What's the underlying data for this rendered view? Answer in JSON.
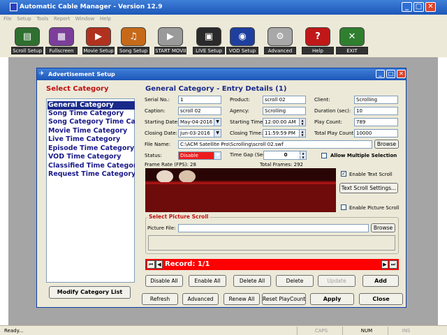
{
  "window": {
    "title": "Automatic Cable Manager - Version 12.9",
    "minimize": "_",
    "restore": "□",
    "close": "✕"
  },
  "menu": [
    "File",
    "Setup",
    "Tools",
    "Report",
    "Window",
    "Help"
  ],
  "toolbar": [
    {
      "label": "Scroll Setup",
      "icon": "scroll-setup-icon",
      "color": "#2f6f2f",
      "glyph": "▤"
    },
    {
      "label": "Fullscreen",
      "icon": "fullscreen-icon",
      "color": "#7b3f9a",
      "glyph": "▦"
    },
    {
      "label": "Movie Setup",
      "icon": "movie-setup-icon",
      "color": "#b0321e",
      "glyph": "▶"
    },
    {
      "label": "Song Setup",
      "icon": "song-setup-icon",
      "color": "#c66a1a",
      "glyph": "♫"
    },
    {
      "label": "START MOVIE",
      "icon": "start-movie-icon",
      "color": "#9a9a9a",
      "glyph": "▶"
    },
    {
      "label": "LIVE Setup",
      "icon": "live-setup-icon",
      "color": "#2a2a2a",
      "glyph": "▣"
    },
    {
      "label": "VOD Setup",
      "icon": "vod-setup-icon",
      "color": "#1f3f9f",
      "glyph": "◉"
    },
    {
      "label": "Advanced",
      "icon": "advanced-icon",
      "color": "#a8a8a8",
      "glyph": "⚙"
    },
    {
      "label": "Help",
      "icon": "help-icon",
      "color": "#c01818",
      "glyph": "?"
    },
    {
      "label": "EXIT",
      "icon": "exit-icon",
      "color": "#2f7f2f",
      "glyph": "✕"
    }
  ],
  "dialog": {
    "title": "Advertisement Setup",
    "select_category_label": "Select Category",
    "categories": [
      "General Category",
      "Song Time Category",
      "Song Category Time Cat",
      "Movie Time Category",
      "Live Time Category",
      "Episode Time Category",
      "VOD Time Category",
      "Classified Time Category",
      "Request Time Category"
    ],
    "modify_button": "Modify Category List",
    "entry_heading": "General Category - Entry Details (1)",
    "fields": {
      "serial_label": "Serial No.:",
      "serial": "1",
      "product_label": "Product:",
      "product": "scroll 02",
      "client_label": "Client:",
      "client": "Scrolling",
      "caption_label": "Caption:",
      "caption": "scroll 02",
      "agency_label": "Agency:",
      "agency": "Scrolling",
      "duration_label": "Duration (sec):",
      "duration": "10",
      "start_date_label": "Starting Date:",
      "start_date": "May-04-2016",
      "start_time_label": "Starting Time:",
      "start_time": "12:00:00 AM",
      "play_count_label": "Play Count:",
      "play_count": "789",
      "closing_date_label": "Closing Date:",
      "closing_date": "Jun-03-2016",
      "closing_time_label": "Closing Time:",
      "closing_time": "11:59:59 PM",
      "total_play_label": "Total Play Count:",
      "total_play": "10000",
      "file_name_label": "File Name:",
      "file_name": "C:\\ACM Satellite Pro\\Scrolling\\scroll 02.swf",
      "status_label": "Status:",
      "status": "Disable",
      "time_gap_label": "Time Gap (Sec):",
      "time_gap": "0",
      "frame_rate": "Frame Rate (FPS): 28",
      "total_frames": "Total Frames: 292"
    },
    "browse_label": "Browse",
    "allow_multiple_label": "Allow Multiple Selection",
    "allow_multiple_checked": false,
    "enable_text_scroll_label": "Enable Text Scroll",
    "enable_text_scroll_checked": true,
    "text_scroll_settings_label": "Text Scroll Settings...",
    "enable_picture_scroll_label": "Enable Picture Scroll",
    "enable_picture_scroll_checked": false,
    "picture_scroll_heading": "Select Picture Scroll",
    "picture_file_label": "Picture File:",
    "picture_browse_label": "Browse",
    "record_label": "Record: 1/1",
    "row_buttons": [
      "Disable All",
      "Enable All",
      "Delete All",
      "Delete",
      "Update",
      "Add"
    ],
    "bottom_buttons": [
      "Refresh",
      "Advanced",
      "Renew All",
      "Reset PlayCount",
      "Apply",
      "Close"
    ]
  },
  "status": {
    "ready": "Ready...",
    "caps": "CAPS",
    "num": "NUM",
    "ins": "INS"
  },
  "colors": {
    "title_blue": "#1d57b9",
    "selection_blue": "#1a2a8a",
    "record_red": "#ff0000",
    "status_red": "#ee1c1c"
  }
}
